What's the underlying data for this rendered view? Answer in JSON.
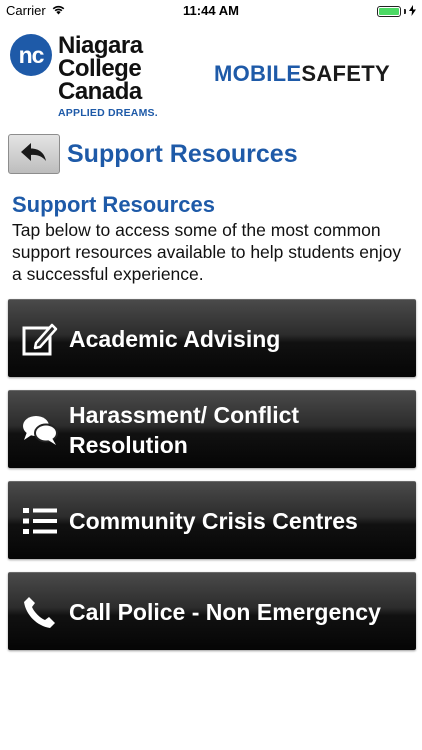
{
  "status_bar": {
    "carrier": "Carrier",
    "time": "11:44 AM"
  },
  "header": {
    "logo_initials": "nc",
    "college_name_lines": [
      "Niagara",
      "College",
      "Canada"
    ],
    "tagline": "APPLIED DREAMS.",
    "app_logo_part1": "MOBILE",
    "app_logo_part2": "SAFETY"
  },
  "nav": {
    "back_icon": "back-arrow-icon",
    "title": "Support Resources"
  },
  "content": {
    "heading": "Support Resources",
    "intro": "Tap below to access some of the most common support resources available to help students enjoy a successful experience."
  },
  "resources": [
    {
      "label": "Academic Advising",
      "icon": "edit-icon"
    },
    {
      "label": "Harassment/ Conflict Resolution",
      "icon": "chat-bubbles-icon"
    },
    {
      "label": "Community Crisis Centres",
      "icon": "list-icon"
    },
    {
      "label": "Call Police - Non Emergency",
      "icon": "phone-icon"
    }
  ],
  "colors": {
    "brand_blue": "#1e5aa8",
    "button_dark": "#1a1a1a",
    "battery_green": "#4cd964"
  }
}
